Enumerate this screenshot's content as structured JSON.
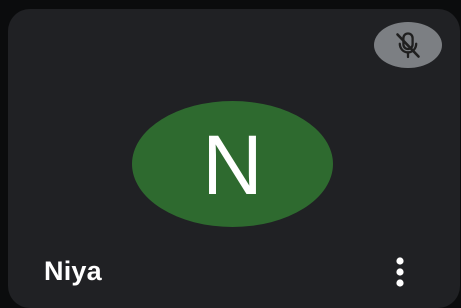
{
  "participant": {
    "name": "Niya",
    "initial": "N",
    "avatar_color": "#2e6a2f"
  },
  "status": {
    "mic": "muted",
    "mute_badge_color": "#7c7f83",
    "mute_icon": "mic-off-icon"
  },
  "controls": {
    "more_icon": "more-vert-icon"
  },
  "colors": {
    "tile_background": "#202124",
    "page_background": "#0b0c0d",
    "text": "#ffffff"
  }
}
